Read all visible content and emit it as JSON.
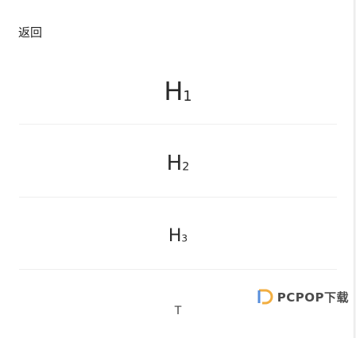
{
  "header": {
    "back_label": "返回"
  },
  "headings": {
    "h1_main": "H",
    "h1_sub": "1",
    "h2_main": "H",
    "h2_sub": "2",
    "h3_main": "H",
    "h3_sub": "3",
    "t_label": "T"
  },
  "watermark": {
    "text": "PCPOP下载"
  }
}
